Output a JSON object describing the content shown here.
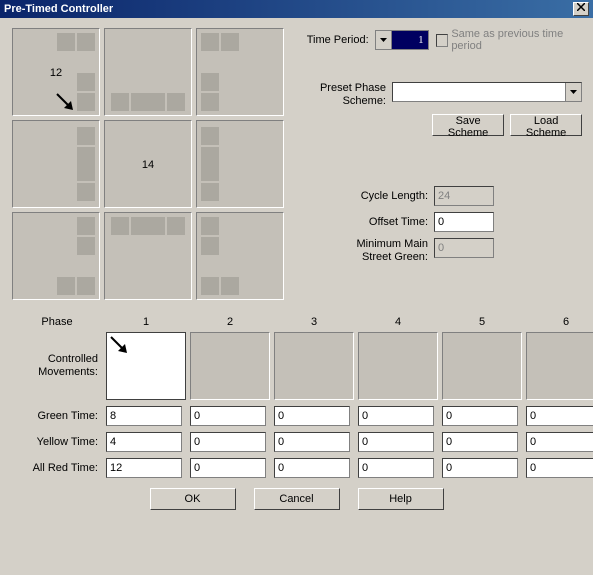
{
  "title": "Pre-Timed Controller",
  "timePeriod": {
    "label": "Time Period:",
    "value": "1"
  },
  "sameAsPrev": "Same as previous time period",
  "presetScheme": {
    "label1": "Preset Phase",
    "label2": "Scheme:",
    "value": ""
  },
  "buttons": {
    "saveScheme": "Save Scheme",
    "loadScheme": "Load Scheme",
    "ok": "OK",
    "cancel": "Cancel",
    "help": "Help"
  },
  "cycleLength": {
    "label": "Cycle Length:",
    "value": "24"
  },
  "offsetTime": {
    "label": "Offset Time:",
    "value": "0"
  },
  "minMainGreen": {
    "label1": "Minimum Main",
    "label2": "Street Green:",
    "value": "0"
  },
  "grid": {
    "cell12": "12",
    "cell14": "14"
  },
  "phases": {
    "headerLabel": "Phase",
    "columns": [
      "1",
      "2",
      "3",
      "4",
      "5",
      "6"
    ],
    "controlledMovements": "Controlled Movements:",
    "rows": {
      "green": {
        "label": "Green Time:",
        "values": [
          "8",
          "0",
          "0",
          "0",
          "0",
          "0"
        ]
      },
      "yellow": {
        "label": "Yellow Time:",
        "values": [
          "4",
          "0",
          "0",
          "0",
          "0",
          "0"
        ]
      },
      "allred": {
        "label": "All Red Time:",
        "values": [
          "12",
          "0",
          "0",
          "0",
          "0",
          "0"
        ]
      }
    }
  }
}
